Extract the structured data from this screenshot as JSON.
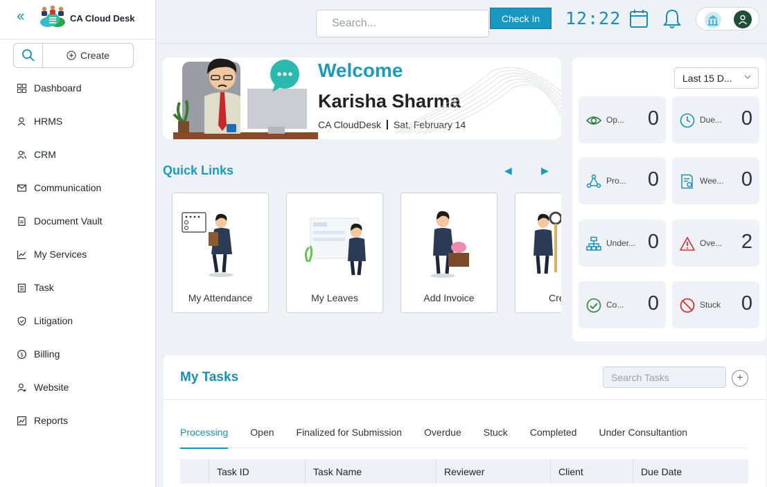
{
  "brand": {
    "name": "CA Cloud Desk"
  },
  "sidebar": {
    "create_label": "Create",
    "items": [
      {
        "label": "Dashboard",
        "icon": "dashboard-icon"
      },
      {
        "label": "HRMS",
        "icon": "person-icon"
      },
      {
        "label": "CRM",
        "icon": "people-icon"
      },
      {
        "label": "Communication",
        "icon": "mail-icon"
      },
      {
        "label": "Document Vault",
        "icon": "document-icon"
      },
      {
        "label": "My Services",
        "icon": "chart-line-icon"
      },
      {
        "label": "Task",
        "icon": "clipboard-icon"
      },
      {
        "label": "Litigation",
        "icon": "shield-icon"
      },
      {
        "label": "Billing",
        "icon": "dollar-icon"
      },
      {
        "label": "Website",
        "icon": "user-globe-icon"
      },
      {
        "label": "Reports",
        "icon": "report-chart-icon"
      }
    ]
  },
  "topbar": {
    "search_placeholder": "Search...",
    "checkin_label": "Check In",
    "clock": "12:22"
  },
  "welcome": {
    "title": "Welcome",
    "name": "Karisha Sharma",
    "org": "CA CloudDesk",
    "date": "Sat, February 14"
  },
  "quick_links": {
    "title": "Quick Links",
    "items": [
      {
        "label": "My Attendance"
      },
      {
        "label": "My Leaves"
      },
      {
        "label": "Add Invoice"
      },
      {
        "label": "Create"
      }
    ]
  },
  "stats": {
    "range": "Last 15 D...",
    "cards": [
      {
        "label": "Op...",
        "value": "0",
        "icon": "eye-icon",
        "color": "#2f7d3a"
      },
      {
        "label": "Due...",
        "value": "0",
        "icon": "clock-icon",
        "color": "#1a8fb5"
      },
      {
        "label": "Pro...",
        "value": "0",
        "icon": "process-icon",
        "color": "#1a8fb5"
      },
      {
        "label": "Wee...",
        "value": "0",
        "icon": "weekly-doc-icon",
        "color": "#1a8fb5"
      },
      {
        "label": "Under...",
        "value": "0",
        "icon": "hierarchy-icon",
        "color": "#1a8fb5"
      },
      {
        "label": "Ove...",
        "value": "2",
        "icon": "warning-icon",
        "color": "#d9302c"
      },
      {
        "label": "Co...",
        "value": "0",
        "icon": "check-circle-icon",
        "color": "#2f7d3a"
      },
      {
        "label": "Stuck",
        "value": "0",
        "icon": "ban-icon",
        "color": "#d9302c"
      }
    ]
  },
  "tasks": {
    "title": "My Tasks",
    "search_placeholder": "Search Tasks",
    "tabs": [
      "Processing",
      "Open",
      "Finalized for Submission",
      "Overdue",
      "Stuck",
      "Completed",
      "Under Consultantion"
    ],
    "columns": [
      "Task ID",
      "Task Name",
      "Reviewer",
      "Client",
      "Due Date"
    ]
  }
}
